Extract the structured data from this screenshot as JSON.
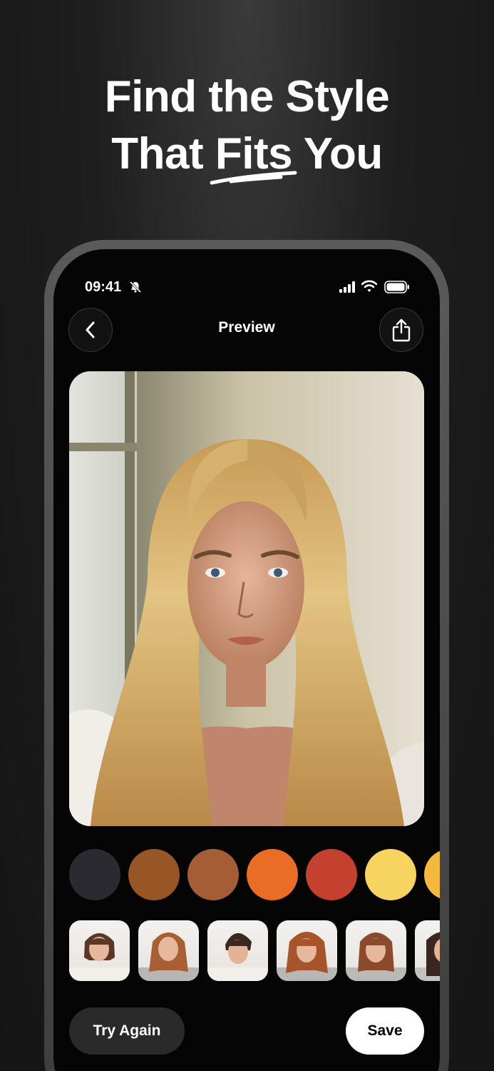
{
  "headline": {
    "line1": "Find the Style",
    "line2_prefix": "That ",
    "line2_highlight": "Fits",
    "line2_suffix": " You"
  },
  "status_bar": {
    "time": "09:41"
  },
  "nav": {
    "title": "Preview"
  },
  "swatches": [
    {
      "name": "black",
      "color": "#2a2a30"
    },
    {
      "name": "brown",
      "color": "#985526"
    },
    {
      "name": "light-brown",
      "color": "#a45d35"
    },
    {
      "name": "orange",
      "color": "#ea6d26"
    },
    {
      "name": "red",
      "color": "#c4402f"
    },
    {
      "name": "yellow",
      "color": "#f7d35f"
    },
    {
      "name": "golden",
      "color": "#f5b83f"
    }
  ],
  "actions": {
    "try_again": "Try Again",
    "save": "Save"
  }
}
